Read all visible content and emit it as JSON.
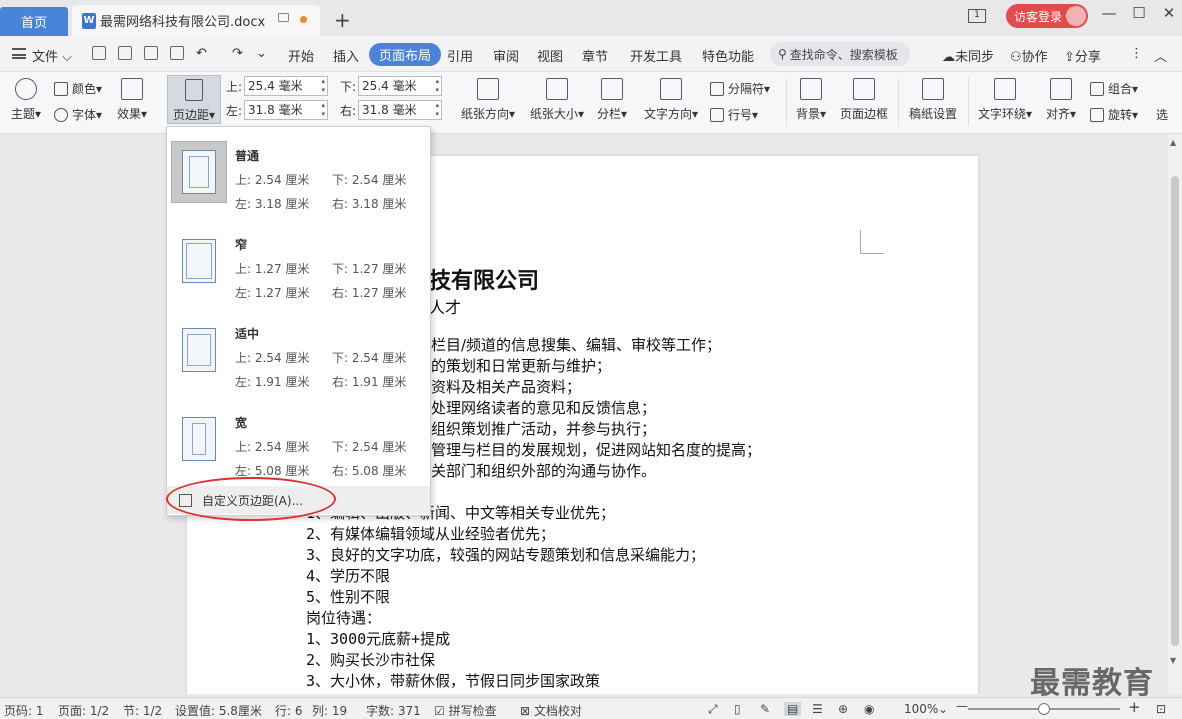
{
  "tabs": {
    "home": "首页",
    "doc_title": "最需网络科技有限公司.docx",
    "visitor_login": "访客登录"
  },
  "menu": {
    "file": "文件",
    "items": [
      "开始",
      "插入",
      "页面布局",
      "引用",
      "审阅",
      "视图",
      "章节",
      "开发工具",
      "特色功能"
    ],
    "active": "页面布局",
    "search": "查找命令、搜索模板",
    "unsynced": "未同步",
    "collaborate": "协作",
    "share": "分享"
  },
  "ribbon": {
    "theme": "主题",
    "color": "颜色",
    "font": "字体",
    "effect": "效果",
    "margin": "页边距",
    "top_label": "上:",
    "top_value": "25.4 毫米",
    "bottom_label": "下:",
    "bottom_value": "25.4 毫米",
    "left_label": "左:",
    "left_value": "31.8 毫米",
    "right_label": "右:",
    "right_value": "31.8 毫米",
    "orientation": "纸张方向",
    "paper_size": "纸张大小",
    "columns": "分栏",
    "text_direction": "文字方向",
    "separator": "分隔符",
    "line_number": "行号",
    "background": "背景",
    "page_border": "页面边框",
    "manuscript": "稿纸设置",
    "text_wrap": "文字环绕",
    "align": "对齐",
    "group": "组合",
    "rotate": "旋转",
    "select": "选"
  },
  "margin_presets": [
    {
      "name": "普通",
      "top": "上: 2.54 厘米",
      "bottom": "下: 2.54 厘米",
      "left": "左: 3.18 厘米",
      "right": "右: 3.18 厘米"
    },
    {
      "name": "窄",
      "top": "上: 1.27 厘米",
      "bottom": "下: 1.27 厘米",
      "left": "左: 1.27 厘米",
      "right": "右: 1.27 厘米"
    },
    {
      "name": "适中",
      "top": "上: 2.54 厘米",
      "bottom": "下: 2.54 厘米",
      "left": "左: 1.91 厘米",
      "right": "右: 1.91 厘米"
    },
    {
      "name": "宽",
      "top": "上: 2.54 厘米",
      "bottom": "下: 2.54 厘米",
      "left": "左: 5.08 厘米",
      "right": "右: 5.08 厘米"
    }
  ],
  "custom_margin": "自定义页边距(A)...",
  "document": {
    "title": "技有限公司",
    "subtitle": "人才",
    "partial_lines": [
      "栏目/频道的信息搜集、编辑、审校等工作；",
      "的策划和日常更新与维护；",
      "资料及相关产品资料；",
      "处理网络读者的意见和反馈信息；",
      "组织策划推广活动，并参与执行；",
      "管理与栏目的发展规划，促进网站知名度的提高；",
      "关部门和组织外部的沟通与协作。"
    ],
    "lines": [
      "1、编辑、出版、新闻、中文等相关专业优先；",
      "2、有媒体编辑领域从业经验者优先；",
      "3、良好的文字功底，较强的网站专题策划和信息采编能力；",
      "4、学历不限",
      "5、性别不限",
      "岗位待遇：",
      "1、3000元底薪+提成",
      "2、购买长沙市社保",
      "3、大小休，带薪休假，节假日同步国家政策"
    ]
  },
  "status": {
    "page_code": "页码: 1",
    "page": "页面: 1/2",
    "section": "节: 1/2",
    "setting": "设置值: 5.8厘米",
    "row": "行: 6",
    "col": "列: 19",
    "words": "字数: 371",
    "spell": "拼写检查",
    "proof": "文档校对",
    "zoom": "100%",
    "zoom_fraction": 0.5
  },
  "watermark": "最需教育",
  "colors": {
    "accent": "#4a84d8",
    "visitor": "#e24b4b",
    "highlight_oval": "#e03030"
  }
}
